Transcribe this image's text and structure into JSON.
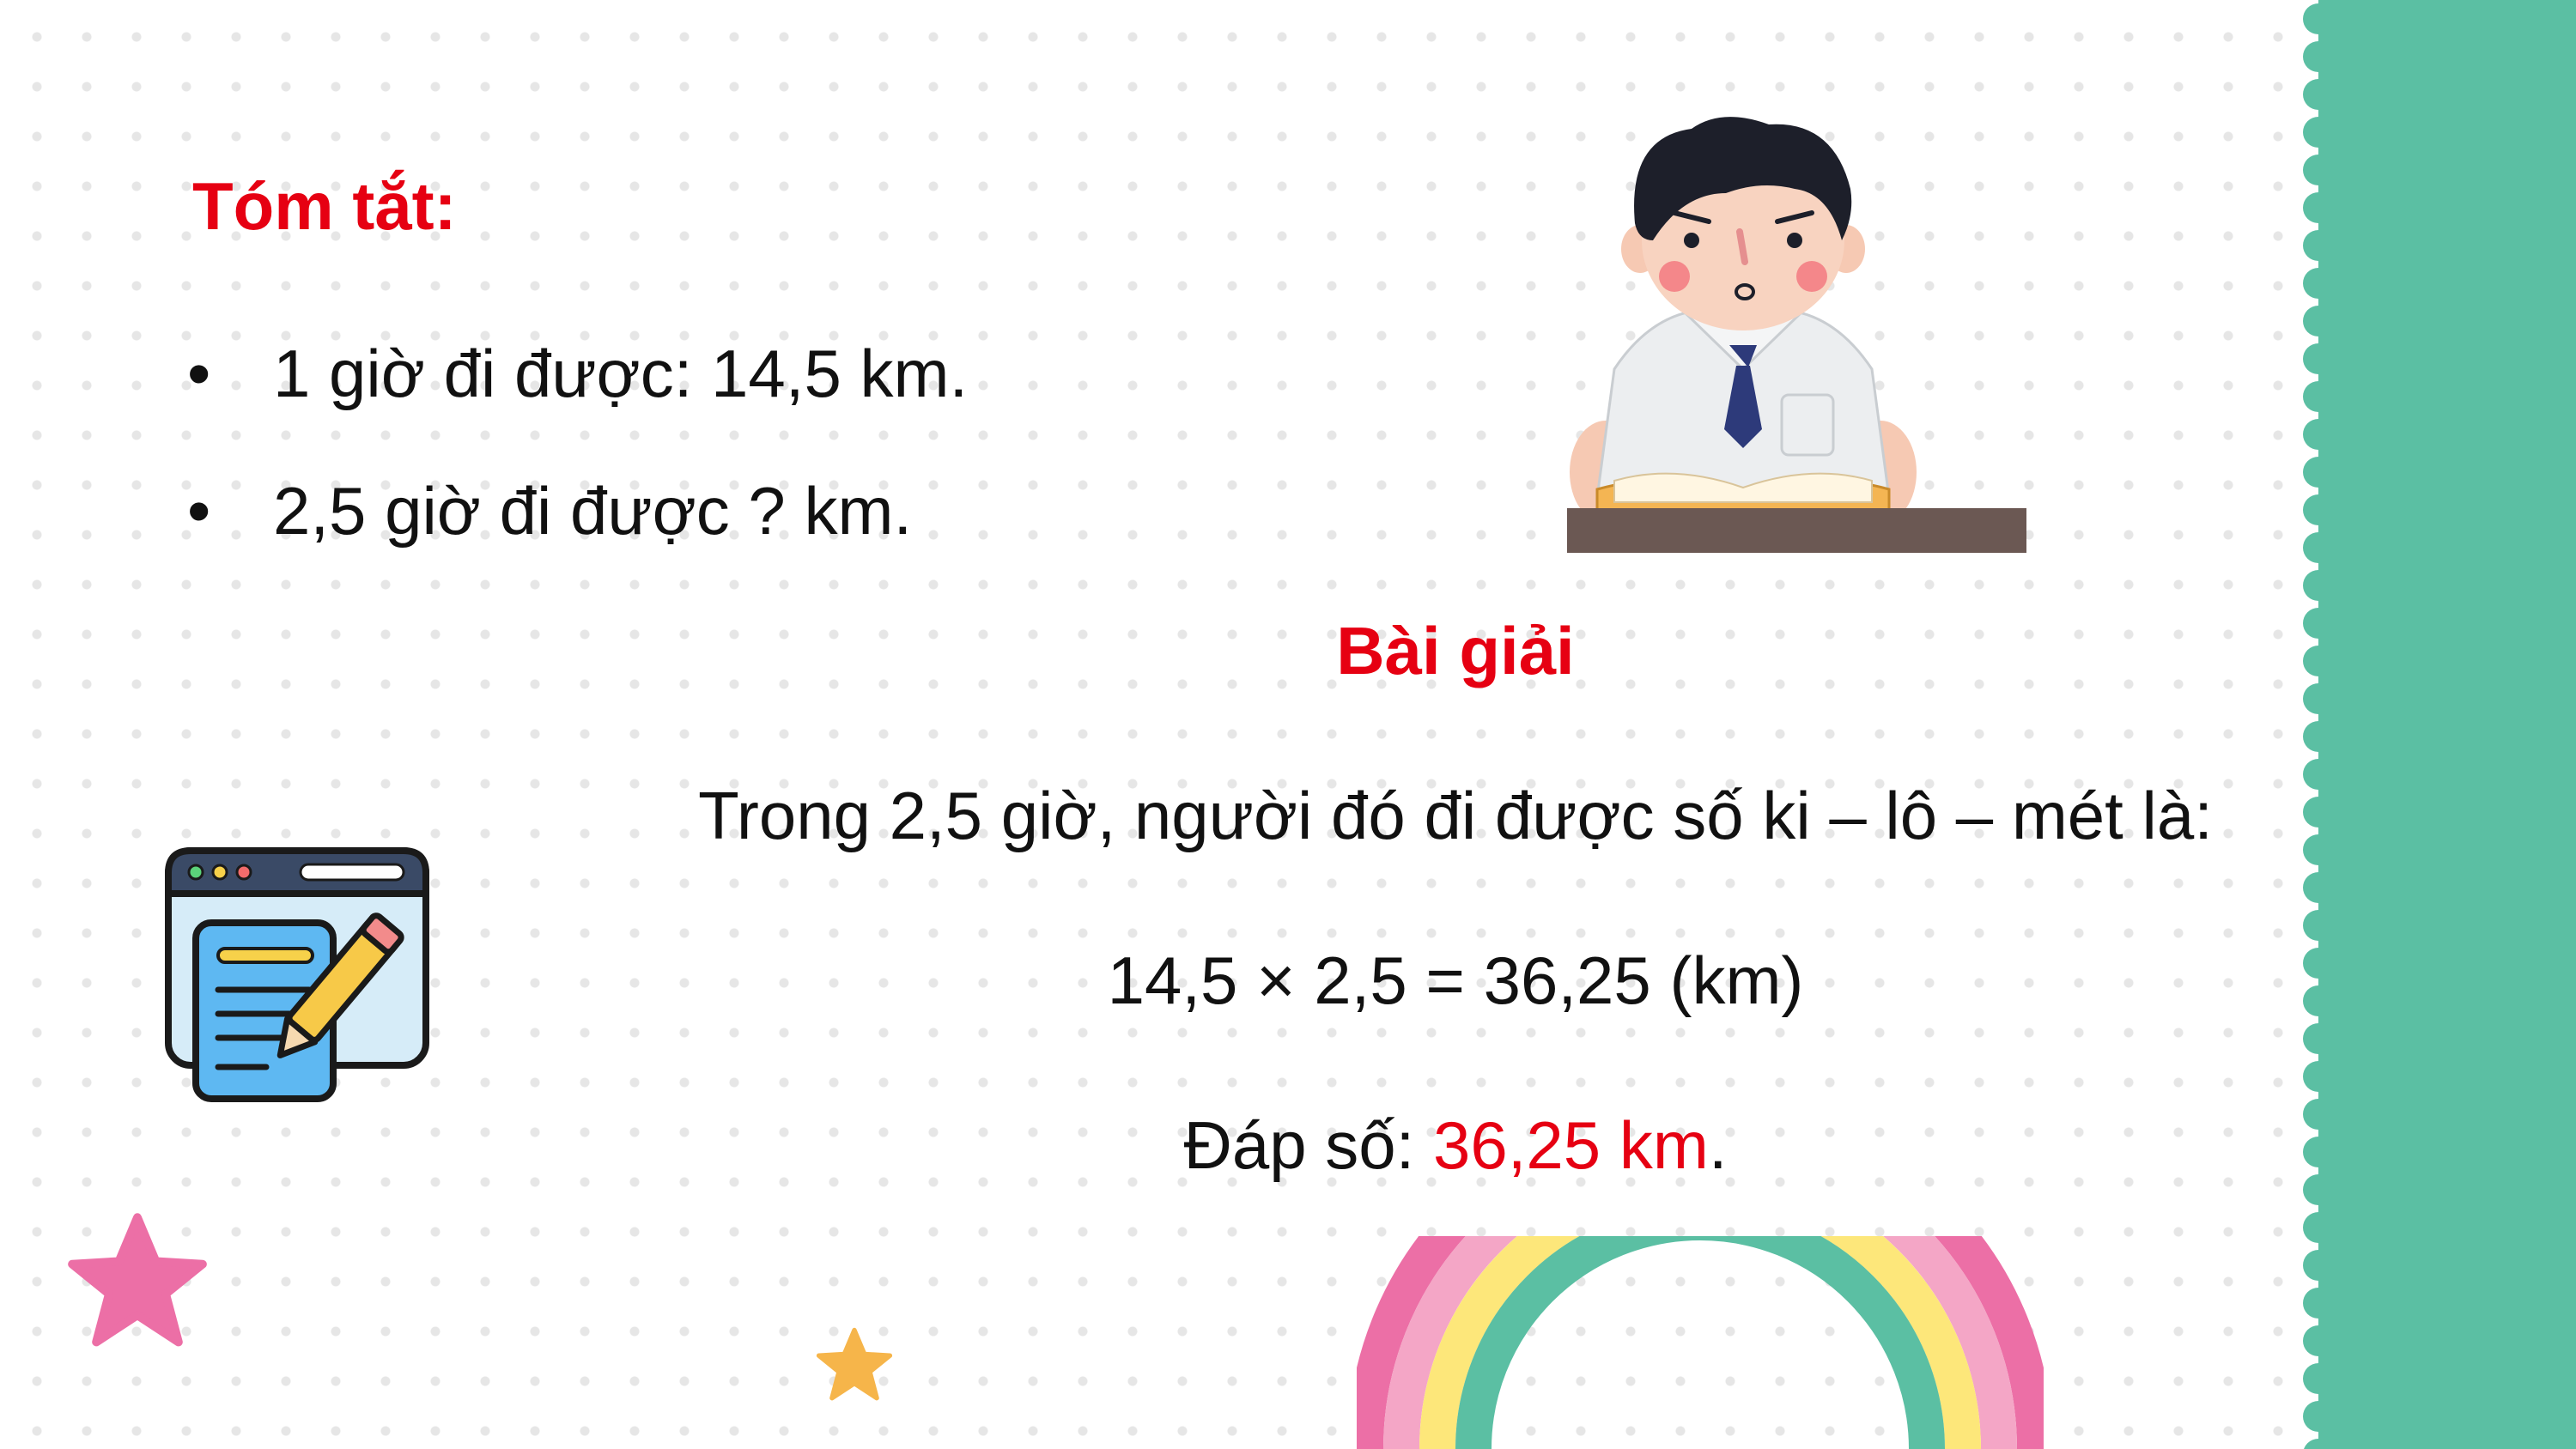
{
  "summary": {
    "title": "Tóm tắt:",
    "items": [
      {
        "bullet": "•",
        "text": "1 giờ đi được: 14,5 km."
      },
      {
        "bullet": "•",
        "text": "2,5 giờ đi được ? km."
      }
    ]
  },
  "solution": {
    "heading": "Bài giải",
    "line1": "Trong 2,5 giờ, người đó đi được số ki – lô – mét là:",
    "line2": "14,5 × 2,5 = 36,25 (km)",
    "answer_label": "Đáp số: ",
    "answer_value": "36,25 km",
    "answer_end": "."
  },
  "colors": {
    "accent_red": "#e60012",
    "side_strip": "#5bbfa3",
    "rainbow": [
      "#ec6fa6",
      "#f4a6c6",
      "#fde77a",
      "#5bbfa3"
    ]
  },
  "icons": [
    "student-reading-illustration",
    "notepad-pencil-icon",
    "star-icon",
    "rainbow-decoration"
  ]
}
